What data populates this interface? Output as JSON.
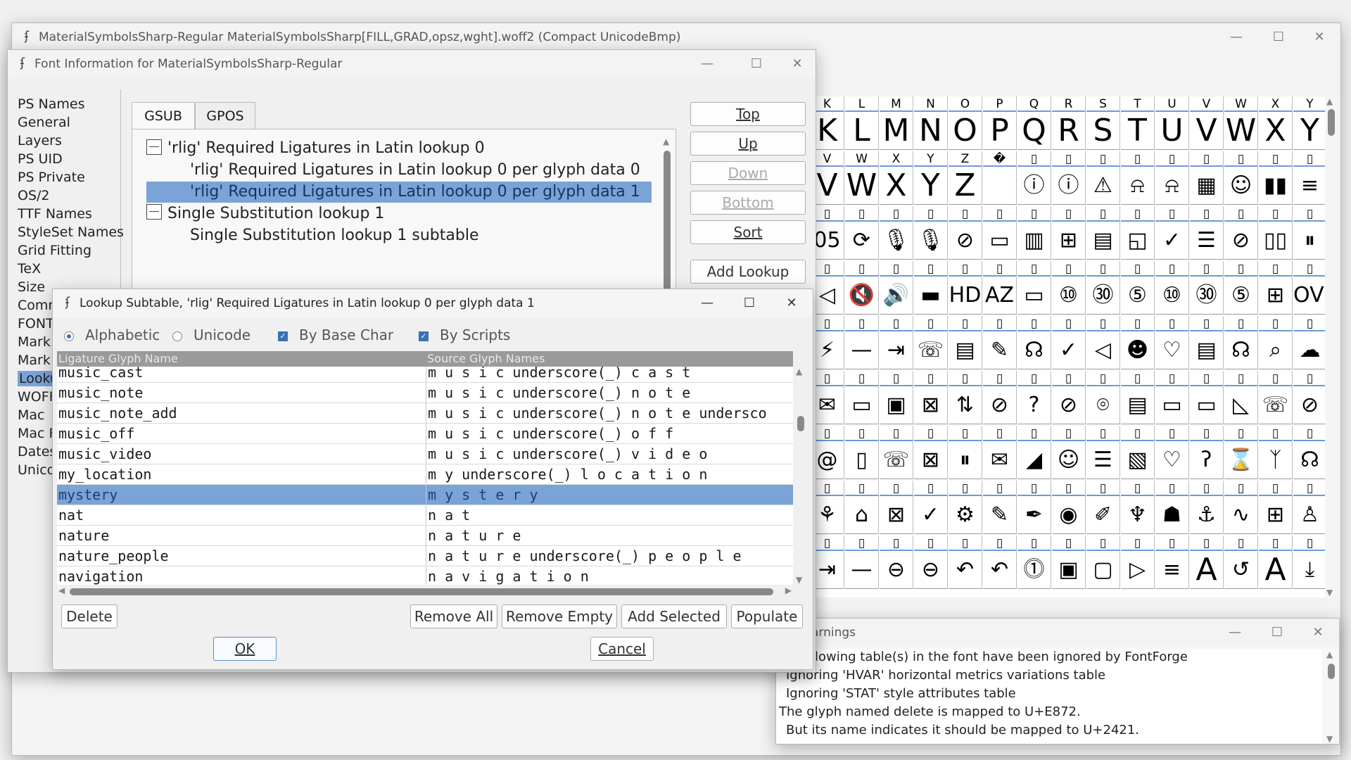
{
  "main_window": {
    "title": "MaterialSymbolsSharp-Regular  MaterialSymbolsSharp[FILL,GRAD,opsz,wght].woff2 (Compact UnicodeBmp)",
    "glyph_rows": [
      {
        "labels": [
          "K",
          "L",
          "M",
          "N",
          "O",
          "P",
          "Q",
          "R",
          "S",
          "T",
          "U",
          "V",
          "W",
          "X",
          "Y"
        ],
        "glyphs": [
          "K",
          "L",
          "M",
          "N",
          "O",
          "P",
          "Q",
          "R",
          "S",
          "T",
          "U",
          "V",
          "W",
          "X",
          "Y"
        ]
      },
      {
        "labels": [
          "V",
          "W",
          "X",
          "Y",
          "Z",
          "�",
          "▯",
          "▯",
          "▯",
          "▯",
          "▯",
          "▯",
          "▯",
          "▯",
          "▯"
        ],
        "glyphs": [
          "V",
          "W",
          "X",
          "Y",
          "Z",
          "",
          "ⓘ",
          "ⓘ",
          "⚠",
          "⍾",
          "⍾",
          "▦",
          "☺",
          "▮▮",
          "≡"
        ]
      },
      {
        "labels": [
          "▯",
          "▯",
          "▯",
          "▯",
          "▯",
          "▯",
          "▯",
          "▯",
          "▯",
          "▯",
          "▯",
          "▯",
          "▯",
          "▯",
          "▯"
        ],
        "glyphs": [
          "05",
          "⟳",
          "🎙",
          "🎙",
          "⊘",
          "▭",
          "▥",
          "⊞",
          "▤",
          "◱",
          "✓",
          "☰",
          "⊘",
          "▯▯",
          "⏸"
        ]
      },
      {
        "labels": [
          "▯",
          "▯",
          "▯",
          "▯",
          "▯",
          "▯",
          "▯",
          "▯",
          "▯",
          "▯",
          "▯",
          "▯",
          "▯",
          "▯",
          "▯"
        ],
        "glyphs": [
          "◁",
          "🔇",
          "🔊",
          "▬",
          "HD",
          "AZ",
          "▭",
          "⑩",
          "㉚",
          "⑤",
          "⑩",
          "㉚",
          "⑤",
          "⊞",
          "OVR"
        ]
      },
      {
        "labels": [
          "▯",
          "▯",
          "▯",
          "▯",
          "▯",
          "▯",
          "▯",
          "▯",
          "▯",
          "▯",
          "▯",
          "▯",
          "▯",
          "▯",
          "▯"
        ],
        "glyphs": [
          "⚡",
          "—",
          "⇥",
          "☏",
          "▤",
          "✎",
          "☊",
          "✓",
          "◁",
          "☻",
          "♡",
          "▤",
          "☊",
          "⌕",
          "☁"
        ]
      },
      {
        "labels": [
          "▯",
          "▯",
          "▯",
          "▯",
          "▯",
          "▯",
          "▯",
          "▯",
          "▯",
          "▯",
          "▯",
          "▯",
          "▯",
          "▯",
          "▯"
        ],
        "glyphs": [
          "✉",
          "▭",
          "▣",
          "⊠",
          "⇅",
          "⊘",
          "?",
          "⊘",
          "⌾",
          "▤",
          "▭",
          "▭",
          "◺",
          "☏",
          "⊘"
        ]
      },
      {
        "labels": [
          "▯",
          "▯",
          "▯",
          "▯",
          "▯",
          "▯",
          "▯",
          "▯",
          "▯",
          "▯",
          "▯",
          "▯",
          "▯",
          "▯",
          "▯"
        ],
        "glyphs": [
          "@",
          "▯",
          "☏",
          "⊠",
          "⏸",
          "✉",
          "◢",
          "☺",
          "☰",
          "▧",
          "♡",
          "ʔ",
          "⌛",
          "ᛉ",
          "☊"
        ]
      },
      {
        "labels": [
          "▯",
          "▯",
          "▯",
          "▯",
          "▯",
          "▯",
          "▯",
          "▯",
          "▯",
          "▯",
          "▯",
          "▯",
          "▯",
          "▯",
          "▯"
        ],
        "glyphs": [
          "⚘",
          "⌂",
          "⊠",
          "✓",
          "⚙",
          "✎",
          "✒",
          "◉",
          "✐",
          "♆",
          "☗",
          "⚓",
          "∿",
          "⊞",
          "♙"
        ]
      },
      {
        "labels": [
          "▯",
          "▯",
          "▯",
          "▯",
          "▯",
          "▯",
          "▯",
          "▯",
          "▯",
          "▯",
          "▯",
          "▯",
          "▯",
          "▯",
          "▯"
        ],
        "glyphs": [
          "⇥",
          "—",
          "⊖",
          "⊖",
          "↶",
          "↶",
          "⓵",
          "▣",
          "▢",
          "▷",
          "≡",
          "A",
          "↺",
          "A",
          "⤓"
        ]
      }
    ]
  },
  "font_info": {
    "title": "Font Information for MaterialSymbolsSharp-Regular",
    "nav": [
      "PS Names",
      "General",
      "Layers",
      "PS UID",
      "PS Private",
      "OS/2",
      "TTF Names",
      "StyleSet Names",
      "Grid Fitting",
      "TeX",
      "Size",
      "Comn",
      "FONT",
      "Mark",
      "Mark",
      "Looku",
      "WOFF",
      "Mac",
      "Mac F",
      "Dates",
      "Unico"
    ],
    "tabs": [
      "GSUB",
      "GPOS"
    ],
    "tree": [
      {
        "text": "'rlig' Required Ligatures in Latin lookup 0",
        "level": 0,
        "box": true
      },
      {
        "text": "'rlig' Required Ligatures in Latin lookup 0 per glyph data 0",
        "level": 1,
        "box": false
      },
      {
        "text": "'rlig' Required Ligatures in Latin lookup 0 per glyph data 1",
        "level": 1,
        "box": false,
        "selected": true
      },
      {
        "text": "Single Substitution lookup 1",
        "level": 0,
        "box": true
      },
      {
        "text": "Single Substitution lookup 1 subtable",
        "level": 1,
        "box": false
      }
    ],
    "buttons": {
      "top": "Top",
      "up": "Up",
      "down": "Down",
      "bottom": "Bottom",
      "sort": "Sort",
      "add_lookup": "Add Lookup"
    }
  },
  "lookup_subtable": {
    "title": "Lookup Subtable, 'rlig' Required Ligatures in Latin lookup 0 per glyph data 1",
    "options": {
      "alphabetic": "Alphabetic",
      "unicode": "Unicode",
      "by_base_char": "By Base Char",
      "by_scripts": "By Scripts"
    },
    "columns": {
      "ligature": "Ligature Glyph Name",
      "source": "Source Glyph Names"
    },
    "rows": [
      {
        "lig": "music_cast",
        "src": "m u s i c underscore(_) c a s t"
      },
      {
        "lig": "music_note",
        "src": "m u s i c underscore(_) n o t e"
      },
      {
        "lig": "music_note_add",
        "src": "m u s i c underscore(_) n o t e undersco"
      },
      {
        "lig": "music_off",
        "src": "m u s i c underscore(_) o f f"
      },
      {
        "lig": "music_video",
        "src": "m u s i c underscore(_) v i d e o"
      },
      {
        "lig": "my_location",
        "src": "m y underscore(_) l o c a t i o n"
      },
      {
        "lig": "mystery",
        "src": "m y s t e r y",
        "selected": true
      },
      {
        "lig": "nat",
        "src": "n a t"
      },
      {
        "lig": "nature",
        "src": "n a t u r e"
      },
      {
        "lig": "nature_people",
        "src": "n a t u r e underscore(_) p e o p l e"
      },
      {
        "lig": "navigation",
        "src": "n a v i g a t i o n"
      }
    ],
    "buttons": {
      "delete": "Delete",
      "remove_all": "Remove All",
      "remove_empty": "Remove Empty",
      "add_selected": "Add Selected",
      "populate": "Populate",
      "ok": "OK",
      "cancel": "Cancel"
    }
  },
  "warnings": {
    "title": "arnings",
    "lines": [
      "llowing table(s) in the font have been ignored by FontForge",
      "Ignoring 'HVAR' horizontal metrics variations table",
      "Ignoring 'STAT' style attributes table",
      "The glyph named delete is mapped to U+E872.",
      "But its name indicates it should be mapped to U+2421."
    ]
  }
}
